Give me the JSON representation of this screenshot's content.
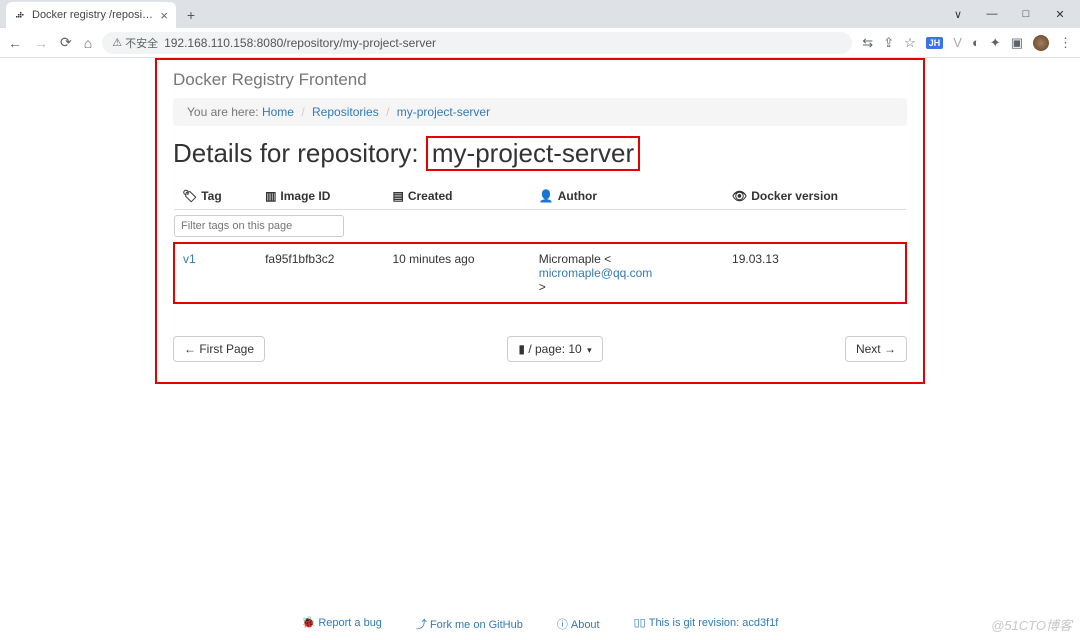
{
  "browser": {
    "tab_title": "Docker registry /repository/m",
    "new_tab": "+",
    "win_min": "—",
    "win_max": "□",
    "win_close": "✕",
    "back": "←",
    "forward": "→",
    "reload": "⟳",
    "home": "⌂",
    "security_label": "不安全",
    "url": "192.168.110.158:8080/repository/my-project-server",
    "ext_translate": "⇆",
    "ext_share": "⇪",
    "ext_star": "☆",
    "ext_jh": "JH",
    "ext_v": "V",
    "ext_dark": "◐",
    "ext_puzzle": "✦",
    "ext_panel": "▣",
    "ext_menu": "⋮"
  },
  "page": {
    "brand": "Docker Registry Frontend",
    "breadcrumb": {
      "here": "You are here:",
      "home": "Home",
      "repos": "Repositories",
      "current": "my-project-server"
    },
    "title_prefix": "Details for repository:",
    "title_repo": "my-project-server",
    "columns": {
      "tag": "Tag",
      "image_id": "Image ID",
      "created": "Created",
      "author": "Author",
      "docker_version": "Docker version"
    },
    "filter_placeholder": "Filter tags on this page",
    "rows": [
      {
        "tag": "v1",
        "image_id": "fa95f1bfb3c2",
        "created": "10 minutes ago",
        "author_name": "Micromaple <",
        "author_email": "micromaple@qq.com",
        "author_close": ">",
        "docker_version": "19.03.13"
      }
    ],
    "pager": {
      "first": "← First Page",
      "per_page_prefix": "/ page: 10",
      "next": "Next →"
    }
  },
  "footer": {
    "bug": "Report a bug",
    "fork": "Fork me on GitHub",
    "about": "About",
    "git_rev_prefix": "This is git revision:",
    "git_rev": "acd3f1f"
  },
  "watermark": "@51CTO博客"
}
